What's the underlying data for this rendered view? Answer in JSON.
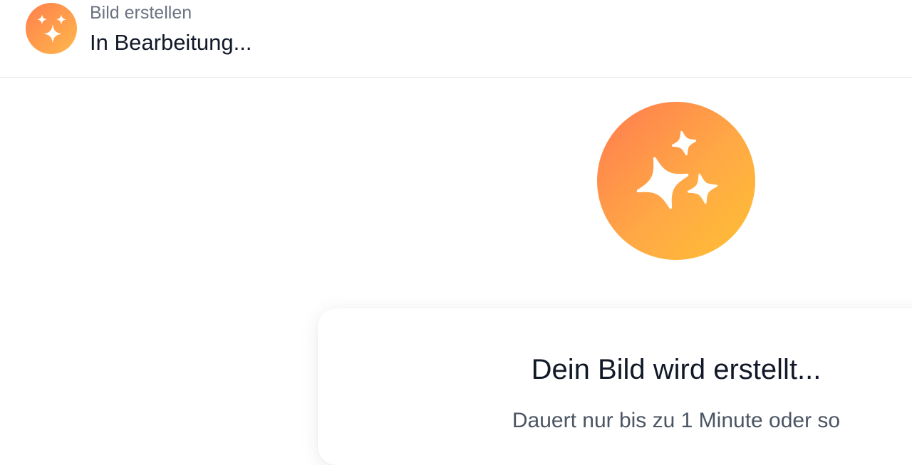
{
  "header": {
    "subtitle": "Bild erstellen",
    "title": "In Bearbeitung...",
    "icon": "sparkles-icon"
  },
  "hero": {
    "icon": "sparkles-icon"
  },
  "card": {
    "title": "Dein Bild wird erstellt...",
    "subtitle": "Dauert nur bis zu 1 Minute oder so"
  },
  "colors": {
    "accent_start": "#ff7a4f",
    "accent_end": "#ffbf33",
    "text_primary": "#111827",
    "text_secondary": "#6b7280",
    "divider": "#e5e7eb"
  }
}
